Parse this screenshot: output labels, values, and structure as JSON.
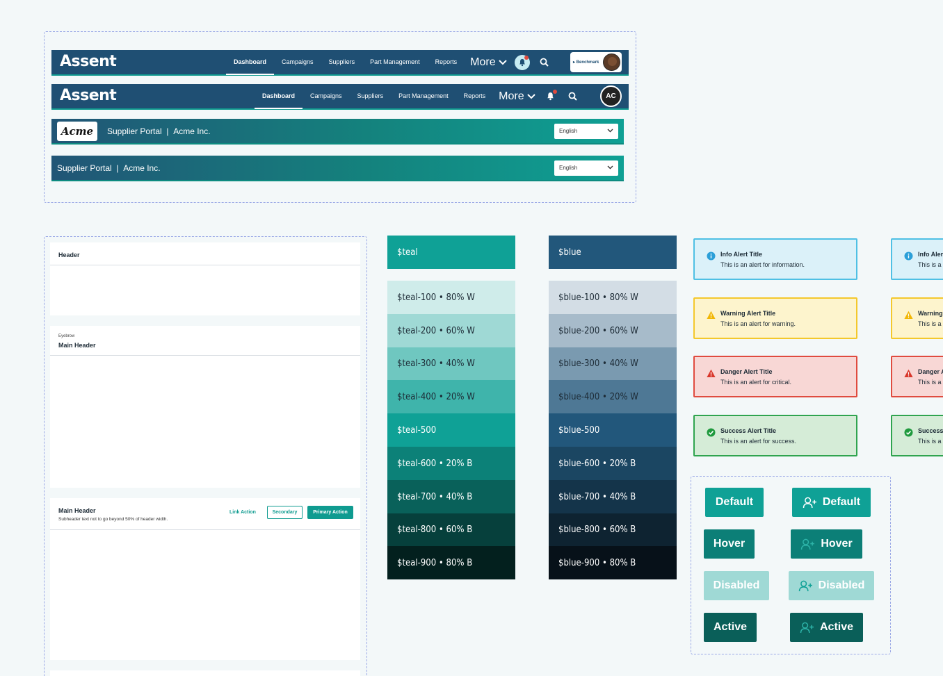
{
  "nav": {
    "logo": "Assent",
    "links": [
      "Dashboard",
      "Campaigns",
      "Suppliers",
      "Part Management",
      "Reports"
    ],
    "more_label": "More",
    "profile_label": "Benchmark",
    "avatar_initials": "AC"
  },
  "portal": {
    "logo_text": "Acme",
    "title": "Supplier Portal",
    "separator": "|",
    "company": "Acme Inc.",
    "language": "English"
  },
  "headers": {
    "h1": "Header",
    "eyebrow": "Eyebrow",
    "h2": "Main Header",
    "h3": "Main Header",
    "h3_sub": "Subheader text not to go beyond 50% of header width.",
    "link_action": "Link Action",
    "secondary": "Secondary",
    "primary": "Primary Action"
  },
  "teal": [
    {
      "label": "$teal",
      "color": "#0fa196",
      "text": "#ffffff"
    },
    {
      "label": "$teal-100 • 80% W",
      "color": "#cfecea",
      "text": "#1d2b36"
    },
    {
      "label": "$teal-200 • 60% W",
      "color": "#9fd9d5",
      "text": "#1d2b36"
    },
    {
      "label": "$teal-300 • 40% W",
      "color": "#6fc7c0",
      "text": "#1d2b36"
    },
    {
      "label": "$teal-400 • 20% W",
      "color": "#3fb4ab",
      "text": "#1d2b36"
    },
    {
      "label": "$teal-500",
      "color": "#0fa196",
      "text": "#ffffff"
    },
    {
      "label": "$teal-600 • 20% B",
      "color": "#0c8178",
      "text": "#ffffff"
    },
    {
      "label": "$teal-700 • 40% B",
      "color": "#09615a",
      "text": "#ffffff"
    },
    {
      "label": "$teal-800 • 60% B",
      "color": "#06403c",
      "text": "#ffffff"
    },
    {
      "label": "$teal-900 • 80% B",
      "color": "#03201e",
      "text": "#ffffff"
    }
  ],
  "blue": [
    {
      "label": "$blue",
      "color": "#22577b",
      "text": "#ffffff"
    },
    {
      "label": "$blue-100 • 80% W",
      "color": "#d3dde5",
      "text": "#1d2b36"
    },
    {
      "label": "$blue-200 • 60% W",
      "color": "#a7bbca",
      "text": "#1d2b36"
    },
    {
      "label": "$blue-300 • 40% W",
      "color": "#7a9ab0",
      "text": "#1d2b36"
    },
    {
      "label": "$blue-400 • 20% W",
      "color": "#4e7895",
      "text": "#1d2b36"
    },
    {
      "label": "$blue-500",
      "color": "#22577b",
      "text": "#ffffff"
    },
    {
      "label": "$blue-600 • 20% B",
      "color": "#1b4662",
      "text": "#ffffff"
    },
    {
      "label": "$blue-700 • 40% B",
      "color": "#14344a",
      "text": "#ffffff"
    },
    {
      "label": "$blue-800 • 60% B",
      "color": "#0e2331",
      "text": "#ffffff"
    },
    {
      "label": "$blue-900 • 80% B",
      "color": "#071119",
      "text": "#ffffff"
    }
  ],
  "alerts": [
    {
      "title": "Info Alert Title",
      "message": "This is an alert for information.",
      "bg": "#dbf1f9",
      "border": "#4fc0e4",
      "icon": "info-icon",
      "icon_color": "#2b9fd8"
    },
    {
      "title": "Warning Alert Title",
      "message": "This is an alert for warning.",
      "bg": "#fdf4cd",
      "border": "#f4c82c",
      "icon": "warning-icon",
      "icon_color": "#f2b705"
    },
    {
      "title": "Danger Alert Title",
      "message": "This is an alert for critical.",
      "bg": "#f8d7d5",
      "border": "#e04b3f",
      "icon": "danger-icon",
      "icon_color": "#d9372b"
    },
    {
      "title": "Success Alert Title",
      "message": "This is an alert for success.",
      "bg": "#d5ecd7",
      "border": "#2fa44f",
      "icon": "check-icon",
      "icon_color": "#1f9a3e"
    }
  ],
  "alerts_clipped": [
    {
      "title": "Info Aler",
      "message": "This is a"
    },
    {
      "title": "Warning",
      "message": "This is a"
    },
    {
      "title": "Danger A",
      "message": "This is a"
    },
    {
      "title": "Success",
      "message": "This is a"
    }
  ],
  "button_states": [
    {
      "label": "Default",
      "color": "#0fa196",
      "text": "#ffffff",
      "icon_color": "#ffffff"
    },
    {
      "label": "Hover",
      "color": "#0c7f77",
      "text": "#ffffff",
      "icon_color": "#2db3a8"
    },
    {
      "label": "Disabled",
      "color": "#9fd9d5",
      "text": "#ffffff",
      "icon_color": "#0fa196"
    },
    {
      "label": "Active",
      "color": "#0a5f59",
      "text": "#ffffff",
      "icon_color": "#2db3a8"
    }
  ]
}
